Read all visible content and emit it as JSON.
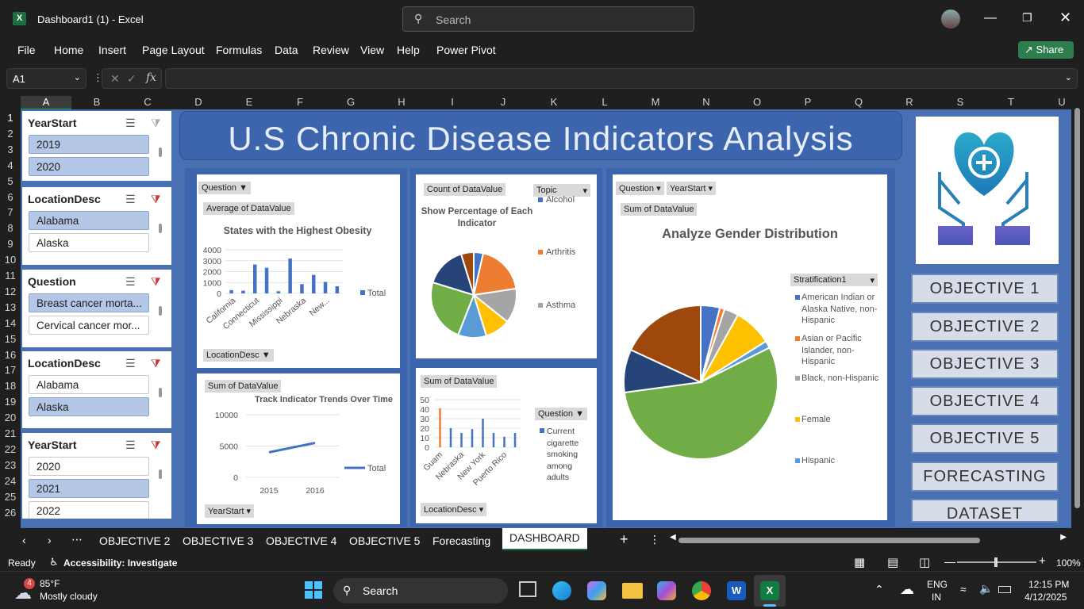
{
  "window": {
    "title": "Dashboard1 (1)  -  Excel",
    "search_placeholder": "Search",
    "share_label": "Share"
  },
  "menu": [
    "File",
    "Home",
    "Insert",
    "Page Layout",
    "Formulas",
    "Data",
    "Review",
    "View",
    "Help",
    "Power Pivot"
  ],
  "formula_bar": {
    "name_box": "A1",
    "fx": "fx",
    "content": ""
  },
  "columns": [
    "A",
    "B",
    "C",
    "D",
    "E",
    "F",
    "G",
    "H",
    "I",
    "J",
    "K",
    "L",
    "M",
    "N",
    "O",
    "P",
    "Q",
    "R",
    "S",
    "T",
    "U"
  ],
  "rows": [
    "1",
    "2",
    "3",
    "4",
    "5",
    "6",
    "7",
    "8",
    "9",
    "10",
    "11",
    "12",
    "13",
    "14",
    "15",
    "16",
    "17",
    "18",
    "19",
    "20",
    "21",
    "22",
    "23",
    "24",
    "25",
    "26"
  ],
  "dashboard_title": "U.S Chronic Disease Indicators Analysis",
  "slicers": [
    {
      "title": "YearStart",
      "items": [
        {
          "label": "2019",
          "selected": true
        },
        {
          "label": "2020",
          "selected": true
        }
      ]
    },
    {
      "title": "LocationDesc",
      "items": [
        {
          "label": "Alabama",
          "selected": true
        },
        {
          "label": "Alaska",
          "selected": false
        }
      ]
    },
    {
      "title": "Question",
      "items": [
        {
          "label": "Breast cancer morta...",
          "selected": true
        },
        {
          "label": "Cervical cancer mor...",
          "selected": false
        }
      ]
    },
    {
      "title": "LocationDesc",
      "items": [
        {
          "label": "Alabama",
          "selected": false
        },
        {
          "label": "Alaska",
          "selected": true
        }
      ]
    },
    {
      "title": "YearStart",
      "items": [
        {
          "label": "2020",
          "selected": false
        },
        {
          "label": "2021",
          "selected": true
        },
        {
          "label": "2022",
          "selected": false
        }
      ]
    }
  ],
  "chart1": {
    "btn_question": "Question",
    "btn_value": "Average of DataValue",
    "btn_axis": "LocationDesc"
  },
  "chart2": {
    "btn_value": "Sum of DataValue",
    "btn_axis": "YearStart"
  },
  "chart3": {
    "btn_value": "Count of DataValue",
    "btn_legend": "Topic"
  },
  "chart4": {
    "btn_value": "Sum of DataValue",
    "btn_axis": "LocationDesc",
    "btn_legend": "Question"
  },
  "chart5": {
    "btn_question": "Question",
    "btn_year": "YearStart",
    "btn_value": "Sum of DataValue",
    "btn_legend": "Stratification1"
  },
  "chart_data": [
    {
      "type": "bar",
      "title": "States with the Highest Obesity",
      "categories": [
        "California",
        "",
        "Connecticut",
        "",
        "Mississippi",
        "",
        "Nebraska",
        "",
        "New...",
        ""
      ],
      "values": [
        300,
        250,
        2650,
        2350,
        200,
        3200,
        850,
        1700,
        1050,
        650
      ],
      "ylim": [
        0,
        4000
      ],
      "yticks": [
        "4000",
        "3000",
        "2000",
        "1000",
        "0"
      ],
      "series": [
        {
          "name": "Total",
          "values": [
            300,
            250,
            2650,
            2350,
            200,
            3200,
            850,
            1700,
            1050,
            650
          ]
        }
      ],
      "colors": [
        "#4472c4"
      ]
    },
    {
      "type": "line",
      "title": "Track Indicator Trends Over Time",
      "x": [
        "2015",
        "2016"
      ],
      "y": [
        4000,
        5500
      ],
      "ylim": [
        0,
        10000
      ],
      "yticks": [
        "10000",
        "5000",
        "0"
      ],
      "series": [
        {
          "name": "Total",
          "values": [
            4000,
            5500
          ]
        }
      ],
      "colors": [
        "#4472c4"
      ]
    },
    {
      "type": "pie",
      "title": "Show Percentage of Each Indicator",
      "legend": [
        "Alcohol",
        "Arthritis",
        "Asthma"
      ],
      "slices": [
        3,
        16,
        11,
        8,
        9,
        20,
        13,
        4
      ],
      "colors": [
        "#4472c4",
        "#ed7d31",
        "#a5a5a5",
        "#ffc000",
        "#5b9bd5",
        "#70ad47",
        "#264478",
        "#9e480e"
      ]
    },
    {
      "type": "bar",
      "categories": [
        "Guam",
        "Nebraska",
        "New York",
        "Puerto Rico"
      ],
      "values": [
        41,
        20,
        15,
        19,
        30,
        15,
        11,
        15
      ],
      "ylim": [
        0,
        50
      ],
      "yticks": [
        "50",
        "40",
        "30",
        "20",
        "10",
        "0"
      ],
      "legend": [
        "Current cigarette smoking among adults"
      ],
      "colors": [
        "#ed7d31",
        "#4472c4"
      ]
    },
    {
      "type": "pie",
      "title": "Analyze Gender Distribution",
      "legend": [
        "American Indian or Alaska Native, non-Hispanic",
        "Asian or Pacific Islander, non-Hispanic",
        "Black, non-Hispanic",
        "Female",
        "Hispanic"
      ],
      "slices": [
        4,
        1,
        3,
        8,
        1.5,
        55,
        9,
        18
      ],
      "colors": [
        "#4472c4",
        "#ed7d31",
        "#a5a5a5",
        "#ffc000",
        "#5b9bd5",
        "#70ad47",
        "#264478",
        "#9e480e"
      ]
    }
  ],
  "objective_buttons": [
    "OBJECTIVE 1",
    "OBJECTIVE 2",
    "OBJECTIVE 3",
    "OBJECTIVE 4",
    "OBJECTIVE 5",
    "FORECASTING",
    "DATASET"
  ],
  "sheet_tabs": [
    {
      "label": "OBJECTIVE 2",
      "active": false
    },
    {
      "label": "OBJECTIVE 3",
      "active": false
    },
    {
      "label": "OBJECTIVE 4",
      "active": false
    },
    {
      "label": "OBJECTIVE 5",
      "active": false
    },
    {
      "label": "Forecasting",
      "active": false
    },
    {
      "label": "DASHBOARD",
      "active": true
    }
  ],
  "status": {
    "ready": "Ready",
    "accessibility": "Accessibility: Investigate",
    "zoom": "100%"
  },
  "taskbar": {
    "weather_temp": "85°F",
    "weather_desc": "Mostly cloudy",
    "weather_badge": "4",
    "search": "Search",
    "lang1": "ENG",
    "lang2": "IN",
    "time": "12:15 PM",
    "date": "4/12/2025"
  }
}
